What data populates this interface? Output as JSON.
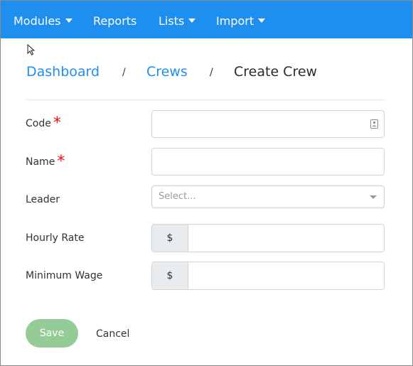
{
  "nav": {
    "modules": "Modules",
    "reports": "Reports",
    "lists": "Lists",
    "import": "Import"
  },
  "breadcrumb": {
    "dashboard": "Dashboard",
    "separator": "/",
    "crews": "Crews",
    "current": "Create Crew"
  },
  "form": {
    "code": {
      "label": "Code",
      "required_mark": "*",
      "value": ""
    },
    "name": {
      "label": "Name",
      "required_mark": "*",
      "value": ""
    },
    "leader": {
      "label": "Leader",
      "placeholder": "Select..."
    },
    "hourly_rate": {
      "label": "Hourly Rate",
      "currency": "$",
      "value": ""
    },
    "minimum_wage": {
      "label": "Minimum Wage",
      "currency": "$",
      "value": ""
    }
  },
  "actions": {
    "save": "Save",
    "cancel": "Cancel"
  },
  "icons": {
    "nav_dropdown": "caret-down-icon",
    "code_field": "contact-card-icon",
    "leader_dropdown": "caret-down-icon",
    "pointer": "mouse-pointer-icon"
  },
  "colors": {
    "navbar": "#1e8fee",
    "link": "#1e8fee",
    "required": "#e8121b",
    "save_button": "#94cb96",
    "addon_bg": "#e9ecef"
  }
}
